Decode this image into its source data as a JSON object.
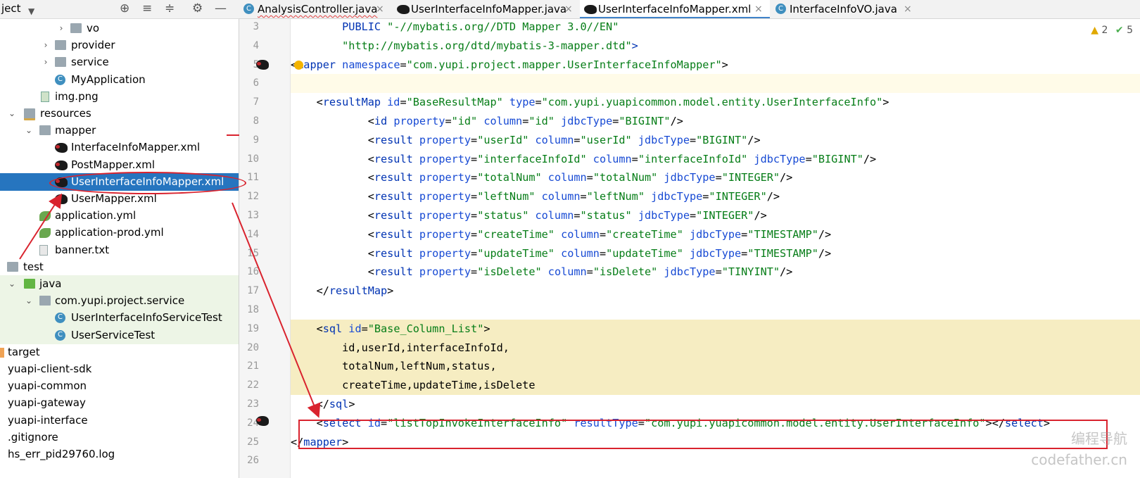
{
  "project_panel": {
    "title": "ject",
    "header_icons": [
      "target-icon",
      "expand-all-icon",
      "collapse-all-icon",
      "gear-icon",
      "minimize-icon"
    ],
    "tree": [
      {
        "label": "vo",
        "icon": "folder-icon",
        "expander": "›"
      },
      {
        "label": "provider",
        "icon": "folder-icon",
        "expander": "›"
      },
      {
        "label": "service",
        "icon": "folder-icon",
        "expander": "›"
      },
      {
        "label": "MyApplication",
        "icon": "spring-class-icon",
        "expander": ""
      },
      {
        "label": "img.png",
        "icon": "image-file-icon",
        "expander": ""
      },
      {
        "label": "resources",
        "icon": "resources-folder-icon",
        "expander": "⌄"
      },
      {
        "label": "mapper",
        "icon": "folder-icon",
        "expander": "⌄"
      },
      {
        "label": "InterfaceInfoMapper.xml",
        "icon": "mybatis-xml-icon",
        "expander": ""
      },
      {
        "label": "PostMapper.xml",
        "icon": "mybatis-xml-icon",
        "expander": ""
      },
      {
        "label": "UserInterfaceInfoMapper.xml",
        "icon": "mybatis-xml-icon",
        "expander": ""
      },
      {
        "label": "UserMapper.xml",
        "icon": "mybatis-xml-icon",
        "expander": ""
      },
      {
        "label": "application.yml",
        "icon": "yml-icon",
        "expander": ""
      },
      {
        "label": "application-prod.yml",
        "icon": "yml-icon",
        "expander": ""
      },
      {
        "label": "banner.txt",
        "icon": "text-file-icon",
        "expander": ""
      },
      {
        "label": "test",
        "icon": "folder-icon",
        "expander": ""
      },
      {
        "label": "java",
        "icon": "test-folder-icon",
        "expander": "⌄"
      },
      {
        "label": "com.yupi.project.service",
        "icon": "package-icon",
        "expander": "⌄"
      },
      {
        "label": "UserInterfaceInfoServiceTest",
        "icon": "class-icon",
        "expander": ""
      },
      {
        "label": "UserServiceTest",
        "icon": "class-icon",
        "expander": ""
      },
      {
        "label": "target",
        "icon": "target-folder-icon",
        "expander": ""
      },
      {
        "label": "yuapi-client-sdk",
        "icon": "",
        "expander": ""
      },
      {
        "label": "yuapi-common",
        "icon": "",
        "expander": ""
      },
      {
        "label": "yuapi-gateway",
        "icon": "",
        "expander": ""
      },
      {
        "label": "yuapi-interface",
        "icon": "",
        "expander": ""
      },
      {
        "label": ".gitignore",
        "icon": "",
        "expander": ""
      },
      {
        "label": "hs_err_pid29760.log",
        "icon": "",
        "expander": ""
      }
    ],
    "selected_index": 9
  },
  "tabs": [
    {
      "label": "AnalysisController.java",
      "icon": "class-icon",
      "active": false
    },
    {
      "label": "UserInterfaceInfoMapper.java",
      "icon": "mybatis-icon",
      "active": false
    },
    {
      "label": "UserInterfaceInfoMapper.xml",
      "icon": "mybatis-icon",
      "active": true
    },
    {
      "label": "InterfaceInfoVO.java",
      "icon": "class-icon",
      "active": false
    }
  ],
  "tab_close_glyph": "×",
  "inspections": {
    "warnings": "2",
    "checks": "5"
  },
  "editor": {
    "lines": [
      {
        "n": "3",
        "segs": [
          [
            "p",
            "        "
          ],
          [
            "t",
            "PUBLIC "
          ],
          [
            "s",
            "\"-//mybatis.org//DTD Mapper 3.0//EN\""
          ]
        ]
      },
      {
        "n": "4",
        "segs": [
          [
            "p",
            "        "
          ],
          [
            "s",
            "\"http://mybatis.org/dtd/mybatis-3-mapper.dtd\""
          ],
          [
            "t",
            ">"
          ]
        ]
      },
      {
        "n": "5",
        "segs": [
          [
            "p",
            "<"
          ],
          [
            "t",
            "mapper "
          ],
          [
            "a",
            "namespace"
          ],
          [
            "p",
            "="
          ],
          [
            "s",
            "\"com.yupi.project.mapper.UserInterfaceInfoMapper\""
          ],
          [
            "p",
            ">"
          ]
        ]
      },
      {
        "n": "6",
        "segs": []
      },
      {
        "n": "7",
        "segs": [
          [
            "p",
            "    <"
          ],
          [
            "t",
            "resultMap "
          ],
          [
            "a",
            "id"
          ],
          [
            "p",
            "="
          ],
          [
            "s",
            "\"BaseResultMap\" "
          ],
          [
            "a",
            "type"
          ],
          [
            "p",
            "="
          ],
          [
            "s",
            "\"com.yupi.yuapicommon.model.entity.UserInterfaceInfo\""
          ],
          [
            "p",
            ">"
          ]
        ]
      },
      {
        "n": "8",
        "segs": [
          [
            "p",
            "            <"
          ],
          [
            "t",
            "id "
          ],
          [
            "a",
            "property"
          ],
          [
            "p",
            "="
          ],
          [
            "s",
            "\"id\" "
          ],
          [
            "a",
            "column"
          ],
          [
            "p",
            "="
          ],
          [
            "s",
            "\"id\" "
          ],
          [
            "a",
            "jdbcType"
          ],
          [
            "p",
            "="
          ],
          [
            "s",
            "\"BIGINT\""
          ],
          [
            "p",
            "/>"
          ]
        ]
      },
      {
        "n": "9",
        "segs": [
          [
            "p",
            "            <"
          ],
          [
            "t",
            "result "
          ],
          [
            "a",
            "property"
          ],
          [
            "p",
            "="
          ],
          [
            "s",
            "\"userId\" "
          ],
          [
            "a",
            "column"
          ],
          [
            "p",
            "="
          ],
          [
            "s",
            "\"userId\" "
          ],
          [
            "a",
            "jdbcType"
          ],
          [
            "p",
            "="
          ],
          [
            "s",
            "\"BIGINT\""
          ],
          [
            "p",
            "/>"
          ]
        ]
      },
      {
        "n": "10",
        "segs": [
          [
            "p",
            "            <"
          ],
          [
            "t",
            "result "
          ],
          [
            "a",
            "property"
          ],
          [
            "p",
            "="
          ],
          [
            "s",
            "\"interfaceInfoId\" "
          ],
          [
            "a",
            "column"
          ],
          [
            "p",
            "="
          ],
          [
            "s",
            "\"interfaceInfoId\" "
          ],
          [
            "a",
            "jdbcType"
          ],
          [
            "p",
            "="
          ],
          [
            "s",
            "\"BIGINT\""
          ],
          [
            "p",
            "/>"
          ]
        ]
      },
      {
        "n": "11",
        "segs": [
          [
            "p",
            "            <"
          ],
          [
            "t",
            "result "
          ],
          [
            "a",
            "property"
          ],
          [
            "p",
            "="
          ],
          [
            "s",
            "\"totalNum\" "
          ],
          [
            "a",
            "column"
          ],
          [
            "p",
            "="
          ],
          [
            "s",
            "\"totalNum\" "
          ],
          [
            "a",
            "jdbcType"
          ],
          [
            "p",
            "="
          ],
          [
            "s",
            "\"INTEGER\""
          ],
          [
            "p",
            "/>"
          ]
        ]
      },
      {
        "n": "12",
        "segs": [
          [
            "p",
            "            <"
          ],
          [
            "t",
            "result "
          ],
          [
            "a",
            "property"
          ],
          [
            "p",
            "="
          ],
          [
            "s",
            "\"leftNum\" "
          ],
          [
            "a",
            "column"
          ],
          [
            "p",
            "="
          ],
          [
            "s",
            "\"leftNum\" "
          ],
          [
            "a",
            "jdbcType"
          ],
          [
            "p",
            "="
          ],
          [
            "s",
            "\"INTEGER\""
          ],
          [
            "p",
            "/>"
          ]
        ]
      },
      {
        "n": "13",
        "segs": [
          [
            "p",
            "            <"
          ],
          [
            "t",
            "result "
          ],
          [
            "a",
            "property"
          ],
          [
            "p",
            "="
          ],
          [
            "s",
            "\"status\" "
          ],
          [
            "a",
            "column"
          ],
          [
            "p",
            "="
          ],
          [
            "s",
            "\"status\" "
          ],
          [
            "a",
            "jdbcType"
          ],
          [
            "p",
            "="
          ],
          [
            "s",
            "\"INTEGER\""
          ],
          [
            "p",
            "/>"
          ]
        ]
      },
      {
        "n": "14",
        "segs": [
          [
            "p",
            "            <"
          ],
          [
            "t",
            "result "
          ],
          [
            "a",
            "property"
          ],
          [
            "p",
            "="
          ],
          [
            "s",
            "\"createTime\" "
          ],
          [
            "a",
            "column"
          ],
          [
            "p",
            "="
          ],
          [
            "s",
            "\"createTime\" "
          ],
          [
            "a",
            "jdbcType"
          ],
          [
            "p",
            "="
          ],
          [
            "s",
            "\"TIMESTAMP\""
          ],
          [
            "p",
            "/>"
          ]
        ]
      },
      {
        "n": "15",
        "segs": [
          [
            "p",
            "            <"
          ],
          [
            "t",
            "result "
          ],
          [
            "a",
            "property"
          ],
          [
            "p",
            "="
          ],
          [
            "s",
            "\"updateTime\" "
          ],
          [
            "a",
            "column"
          ],
          [
            "p",
            "="
          ],
          [
            "s",
            "\"updateTime\" "
          ],
          [
            "a",
            "jdbcType"
          ],
          [
            "p",
            "="
          ],
          [
            "s",
            "\"TIMESTAMP\""
          ],
          [
            "p",
            "/>"
          ]
        ]
      },
      {
        "n": "16",
        "segs": [
          [
            "p",
            "            <"
          ],
          [
            "t",
            "result "
          ],
          [
            "a",
            "property"
          ],
          [
            "p",
            "="
          ],
          [
            "s",
            "\"isDelete\" "
          ],
          [
            "a",
            "column"
          ],
          [
            "p",
            "="
          ],
          [
            "s",
            "\"isDelete\" "
          ],
          [
            "a",
            "jdbcType"
          ],
          [
            "p",
            "="
          ],
          [
            "s",
            "\"TINYINT\""
          ],
          [
            "p",
            "/>"
          ]
        ]
      },
      {
        "n": "17",
        "segs": [
          [
            "p",
            "    </"
          ],
          [
            "t",
            "resultMap"
          ],
          [
            "p",
            ">"
          ]
        ]
      },
      {
        "n": "18",
        "segs": []
      },
      {
        "n": "19",
        "segs": [
          [
            "p",
            "    <"
          ],
          [
            "t",
            "sql "
          ],
          [
            "a",
            "id"
          ],
          [
            "p",
            "="
          ],
          [
            "s",
            "\"Base_Column_List\""
          ],
          [
            "p",
            ">"
          ]
        ]
      },
      {
        "n": "20",
        "segs": [
          [
            "p",
            "        id,userId,interfaceInfoId,"
          ]
        ]
      },
      {
        "n": "21",
        "segs": [
          [
            "p",
            "        totalNum,leftNum,status,"
          ]
        ]
      },
      {
        "n": "22",
        "segs": [
          [
            "p",
            "        createTime,updateTime,isDelete"
          ]
        ]
      },
      {
        "n": "23",
        "segs": [
          [
            "p",
            "    </"
          ],
          [
            "t",
            "sql"
          ],
          [
            "p",
            ">"
          ]
        ]
      },
      {
        "n": "24",
        "segs": [
          [
            "p",
            "    <"
          ],
          [
            "t",
            "select "
          ],
          [
            "a",
            "id"
          ],
          [
            "p",
            "="
          ],
          [
            "s",
            "\"listTopInvokeInterfaceInfo\" "
          ],
          [
            "a",
            "resultType"
          ],
          [
            "p",
            "="
          ],
          [
            "s",
            "\"com.yupi.yuapicommon.model.entity.UserInterfaceInfo\""
          ],
          [
            "p",
            "></"
          ],
          [
            "t",
            "select"
          ],
          [
            "p",
            ">"
          ]
        ]
      },
      {
        "n": "25",
        "segs": [
          [
            "p",
            "</"
          ],
          [
            "t",
            "mapper"
          ],
          [
            "p",
            ">"
          ]
        ]
      },
      {
        "n": "26",
        "segs": []
      }
    ]
  },
  "watermark": {
    "line1": "编程导航",
    "line2": "codefather.cn"
  },
  "colors": {
    "selection": "#2675bf",
    "annotation_red": "#d9232e",
    "tag": "#0033b3",
    "attr": "#174ad4",
    "string": "#067d17"
  }
}
